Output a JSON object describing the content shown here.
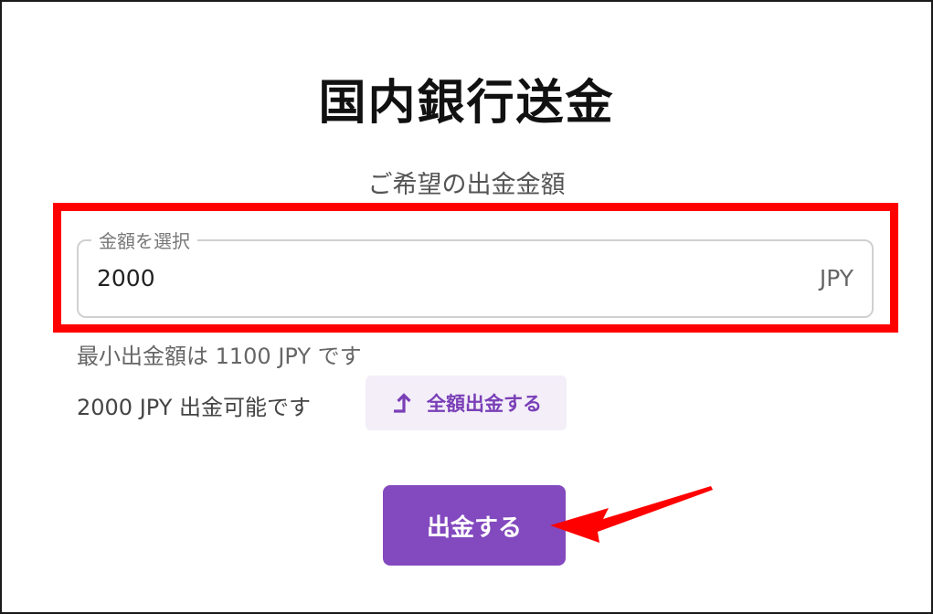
{
  "page": {
    "title": "国内銀行送金",
    "subtitle": "ご希望の出金金額"
  },
  "amount_field": {
    "legend": "金額を選択",
    "value": "2000",
    "currency": "JPY"
  },
  "notes": {
    "minimum": "最小出金額は 1100 JPY です",
    "available": "2000 JPY 出金可能です"
  },
  "withdraw_all": {
    "label": "全額出金する",
    "icon": "arrow-up-icon"
  },
  "submit": {
    "label": "出金する"
  },
  "colors": {
    "accent": "#8349bf",
    "annotation": "#ff0000"
  }
}
